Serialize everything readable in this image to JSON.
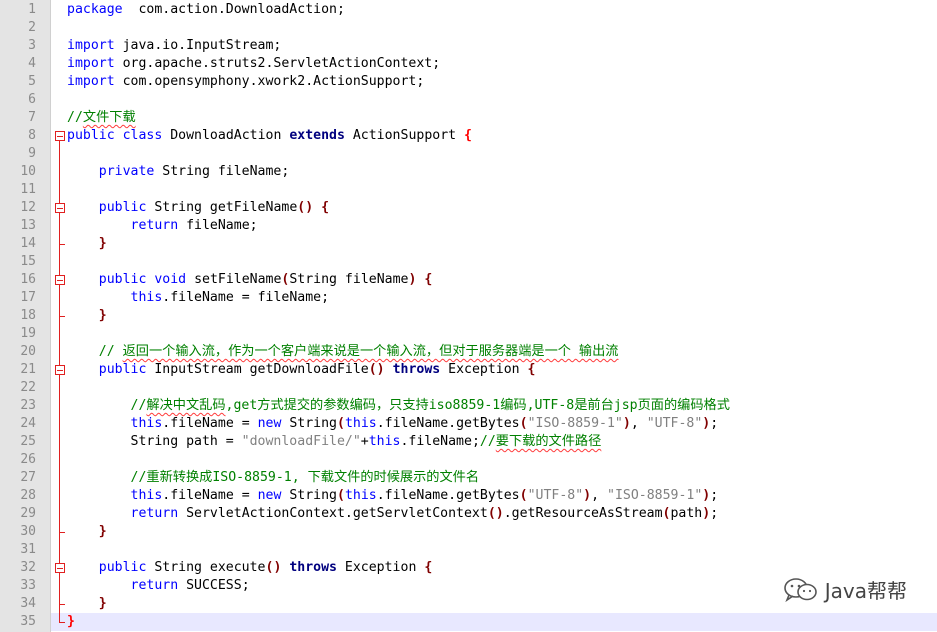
{
  "editor": {
    "lines": [
      {
        "n": "1",
        "parts": [
          [
            "kw",
            "package"
          ],
          [
            "",
            "  com.action.DownloadAction;"
          ]
        ]
      },
      {
        "n": "2",
        "parts": []
      },
      {
        "n": "3",
        "parts": [
          [
            "kw",
            "import"
          ],
          [
            "",
            " java.io.InputStream;"
          ]
        ]
      },
      {
        "n": "4",
        "parts": [
          [
            "kw",
            "import"
          ],
          [
            "",
            " org.apache.struts2.ServletActionContext;"
          ]
        ]
      },
      {
        "n": "5",
        "parts": [
          [
            "kw",
            "import"
          ],
          [
            "",
            " com.opensymphony.xwork2.ActionSupport;"
          ]
        ]
      },
      {
        "n": "6",
        "parts": []
      },
      {
        "n": "7",
        "parts": [
          [
            "cm",
            "//"
          ],
          [
            "cmu",
            "文件下载"
          ]
        ]
      },
      {
        "n": "8",
        "parts": [
          [
            "kw",
            "public"
          ],
          [
            "",
            " "
          ],
          [
            "kw",
            "class"
          ],
          [
            "",
            " DownloadAction "
          ],
          [
            "kb",
            "extends"
          ],
          [
            "",
            " ActionSupport "
          ],
          [
            "brr",
            "{"
          ]
        ]
      },
      {
        "n": "9",
        "parts": []
      },
      {
        "n": "10",
        "parts": [
          [
            "",
            "    "
          ],
          [
            "kw",
            "private"
          ],
          [
            "",
            " String fileName;"
          ]
        ]
      },
      {
        "n": "11",
        "parts": []
      },
      {
        "n": "12",
        "parts": [
          [
            "",
            "    "
          ],
          [
            "kw",
            "public"
          ],
          [
            "",
            " String getFileName"
          ],
          [
            "br",
            "()"
          ],
          [
            "",
            " "
          ],
          [
            "br",
            "{"
          ]
        ]
      },
      {
        "n": "13",
        "parts": [
          [
            "",
            "        "
          ],
          [
            "kw",
            "return"
          ],
          [
            "",
            " fileName;"
          ]
        ]
      },
      {
        "n": "14",
        "parts": [
          [
            "",
            "    "
          ],
          [
            "br",
            "}"
          ]
        ]
      },
      {
        "n": "15",
        "parts": []
      },
      {
        "n": "16",
        "parts": [
          [
            "",
            "    "
          ],
          [
            "kw",
            "public"
          ],
          [
            "",
            " "
          ],
          [
            "kw",
            "void"
          ],
          [
            "",
            " setFileName"
          ],
          [
            "br",
            "("
          ],
          [
            "",
            "String fileName"
          ],
          [
            "br",
            ")"
          ],
          [
            "",
            " "
          ],
          [
            "br",
            "{"
          ]
        ]
      },
      {
        "n": "17",
        "parts": [
          [
            "",
            "        "
          ],
          [
            "kw",
            "this"
          ],
          [
            "",
            ".fileName = fileName;"
          ]
        ]
      },
      {
        "n": "18",
        "parts": [
          [
            "",
            "    "
          ],
          [
            "br",
            "}"
          ]
        ]
      },
      {
        "n": "19",
        "parts": []
      },
      {
        "n": "20",
        "parts": [
          [
            "",
            "    "
          ],
          [
            "cm",
            "// "
          ],
          [
            "cmu",
            "返回一个输入流，作为一个客户端来说是一个输入流，但对于服务器端是一个 输出流"
          ]
        ]
      },
      {
        "n": "21",
        "parts": [
          [
            "",
            "    "
          ],
          [
            "kw",
            "public"
          ],
          [
            "",
            " InputStream getDownloadFile"
          ],
          [
            "br",
            "()"
          ],
          [
            "",
            " "
          ],
          [
            "kb",
            "throws"
          ],
          [
            "",
            " Exception "
          ],
          [
            "br",
            "{"
          ]
        ]
      },
      {
        "n": "22",
        "parts": []
      },
      {
        "n": "23",
        "parts": [
          [
            "",
            "        "
          ],
          [
            "cm",
            "//"
          ],
          [
            "cmu",
            "解决中文乱码"
          ],
          [
            "cm",
            ",get方式提交的参数编码，只支持iso8859-1编码,UTF-8是前台jsp页面的编码格式"
          ]
        ]
      },
      {
        "n": "24",
        "parts": [
          [
            "",
            "        "
          ],
          [
            "kw",
            "this"
          ],
          [
            "",
            ".fileName = "
          ],
          [
            "kw",
            "new"
          ],
          [
            "",
            " String"
          ],
          [
            "br",
            "("
          ],
          [
            "kw",
            "this"
          ],
          [
            "",
            ".fileName.getBytes"
          ],
          [
            "br",
            "("
          ],
          [
            "st",
            "\"ISO-8859-1\""
          ],
          [
            "br",
            ")"
          ],
          [
            "",
            ", "
          ],
          [
            "st",
            "\"UTF-8\""
          ],
          [
            "br",
            ")"
          ],
          [
            "",
            ";"
          ]
        ]
      },
      {
        "n": "25",
        "parts": [
          [
            "",
            "        String path = "
          ],
          [
            "st",
            "\"downloadFile/\""
          ],
          [
            "",
            "+"
          ],
          [
            "kw",
            "this"
          ],
          [
            "",
            ".fileName;"
          ],
          [
            "cm",
            "//"
          ],
          [
            "cmu",
            "要下载的文件路径"
          ]
        ]
      },
      {
        "n": "26",
        "parts": []
      },
      {
        "n": "27",
        "parts": [
          [
            "",
            "        "
          ],
          [
            "cm",
            "//重新转换成ISO-8859-1, 下载文件的时候展示的文件名"
          ]
        ]
      },
      {
        "n": "28",
        "parts": [
          [
            "",
            "        "
          ],
          [
            "kw",
            "this"
          ],
          [
            "",
            ".fileName = "
          ],
          [
            "kw",
            "new"
          ],
          [
            "",
            " String"
          ],
          [
            "br",
            "("
          ],
          [
            "kw",
            "this"
          ],
          [
            "",
            ".fileName.getBytes"
          ],
          [
            "br",
            "("
          ],
          [
            "st",
            "\"UTF-8\""
          ],
          [
            "br",
            ")"
          ],
          [
            "",
            ", "
          ],
          [
            "st",
            "\"ISO-8859-1\""
          ],
          [
            "br",
            ")"
          ],
          [
            "",
            ";"
          ]
        ]
      },
      {
        "n": "29",
        "parts": [
          [
            "",
            "        "
          ],
          [
            "kw",
            "return"
          ],
          [
            "",
            " ServletActionContext.getServletContext"
          ],
          [
            "br",
            "()"
          ],
          [
            "",
            ".getResourceAsStream"
          ],
          [
            "br",
            "("
          ],
          [
            "",
            "path"
          ],
          [
            "br",
            ")"
          ],
          [
            "",
            ";"
          ]
        ]
      },
      {
        "n": "30",
        "parts": [
          [
            "",
            "    "
          ],
          [
            "br",
            "}"
          ]
        ]
      },
      {
        "n": "31",
        "parts": []
      },
      {
        "n": "32",
        "parts": [
          [
            "",
            "    "
          ],
          [
            "kw",
            "public"
          ],
          [
            "",
            " String execute"
          ],
          [
            "br",
            "()"
          ],
          [
            "",
            " "
          ],
          [
            "kb",
            "throws"
          ],
          [
            "",
            " Exception "
          ],
          [
            "br",
            "{"
          ]
        ]
      },
      {
        "n": "33",
        "parts": [
          [
            "",
            "        "
          ],
          [
            "kw",
            "return"
          ],
          [
            "",
            " SUCCESS;"
          ]
        ]
      },
      {
        "n": "34",
        "parts": [
          [
            "",
            "    "
          ],
          [
            "br",
            "}"
          ]
        ]
      },
      {
        "n": "35",
        "parts": [
          [
            "brr",
            "}"
          ]
        ]
      }
    ],
    "current_line": "35",
    "colors": {
      "keyword": "#0000ff",
      "comment": "#008000",
      "string": "#808080",
      "fold": "#e02020"
    }
  },
  "watermark": {
    "text": "Java帮帮"
  }
}
